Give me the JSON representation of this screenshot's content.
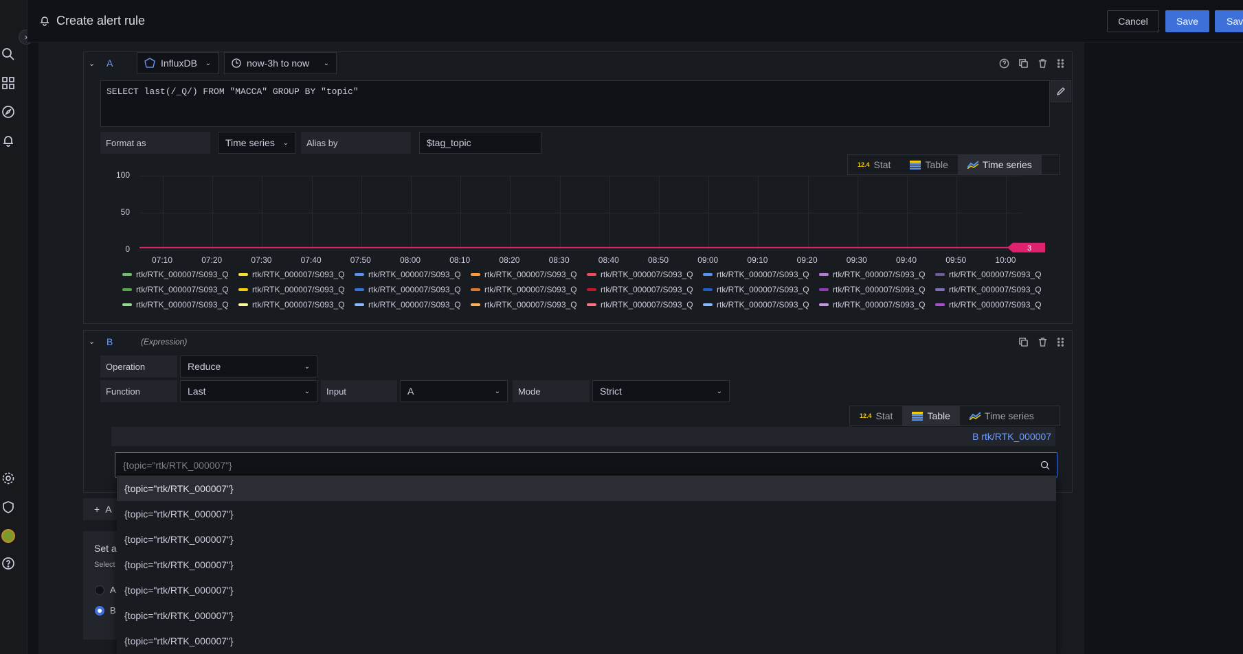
{
  "header": {
    "title": "Create alert rule",
    "cancel": "Cancel",
    "save": "Save",
    "save_exit": "Save"
  },
  "queryA": {
    "ref": "A",
    "datasource": "InfluxDB",
    "time_range": "now-3h to now",
    "query": "SELECT last(/_Q/) FROM \"MACCA\" GROUP BY \"topic\"",
    "format_label": "Format as",
    "format_value": "Time series",
    "alias_label": "Alias by",
    "alias_value": "$tag_topic",
    "viz": {
      "stat": "Stat",
      "table": "Table",
      "timeseries": "Time series",
      "active": "timeseries"
    }
  },
  "chart_data": {
    "type": "line",
    "x": [
      "07:10",
      "07:20",
      "07:30",
      "07:40",
      "07:50",
      "08:00",
      "08:10",
      "08:20",
      "08:30",
      "08:40",
      "08:50",
      "09:00",
      "09:10",
      "09:20",
      "09:30",
      "09:40",
      "09:50",
      "10:00"
    ],
    "y_ticks": [
      "100",
      "50",
      "0"
    ],
    "ylim": [
      0,
      100
    ],
    "series": [
      {
        "values": [
          3,
          3,
          3,
          3,
          3,
          3,
          3,
          3,
          3,
          3,
          3,
          3,
          3,
          3,
          3,
          3,
          3,
          3
        ],
        "color": "#e0226e"
      }
    ],
    "last_value_label": "3",
    "legend_label": "rtk/RTK_000007/S093_Q",
    "legend_colors": [
      [
        "#73bf69",
        "#fade2a",
        "#5794f2",
        "#ff9830",
        "#f2495c",
        "#5794f2",
        "#b877d9",
        "#705da0"
      ],
      [
        "#56a64b",
        "#f2cc0c",
        "#3274d9",
        "#e0752d",
        "#c4162a",
        "#1f60c4",
        "#8f3bb8",
        "#806eb7"
      ],
      [
        "#96d98d",
        "#fff899",
        "#8ab8ff",
        "#ffb357",
        "#ff7383",
        "#8ab8ff",
        "#ca95e5",
        "#a352cc"
      ]
    ]
  },
  "queryB": {
    "ref": "B",
    "type": "(Expression)",
    "operation_label": "Operation",
    "operation_value": "Reduce",
    "function_label": "Function",
    "function_value": "Last",
    "input_label": "Input",
    "input_value": "A",
    "mode_label": "Mode",
    "mode_value": "Strict",
    "viz": {
      "stat": "Stat",
      "table": "Table",
      "timeseries": "Time series",
      "active": "table"
    },
    "table_header": "B rtk/RTK_000007",
    "series_select_value": "{topic=\"rtk/RTK_000007\"}",
    "options": [
      "{topic=\"rtk/RTK_000007\"}",
      "{topic=\"rtk/RTK_000007\"}",
      "{topic=\"rtk/RTK_000007\"}",
      "{topic=\"rtk/RTK_000007\"}",
      "{topic=\"rtk/RTK_000007\"}",
      "{topic=\"rtk/RTK_000007\"}",
      "{topic=\"rtk/RTK_000007\"}"
    ]
  },
  "below": {
    "add_label": "A",
    "set_alert": "Set a",
    "select_hint": "Select",
    "radio_a": "A",
    "radio_b": "B"
  }
}
